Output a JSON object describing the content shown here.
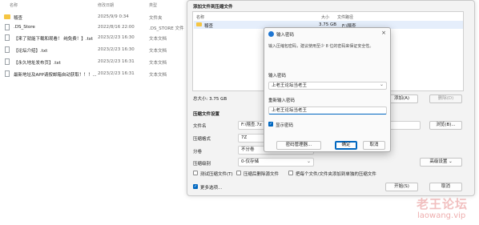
{
  "file_list": {
    "headers": {
      "name": "名称",
      "date": "修改日期",
      "type": "类型"
    },
    "rows": [
      {
        "name": "稽查",
        "date": "2025/9/9 0:34",
        "type": "文件夹",
        "icon": "folder-icon"
      },
      {
        "name": ".DS_Store",
        "date": "2022/8/16 22:00",
        "type": ".DS_STORE 文件",
        "icon": "file-icon"
      },
      {
        "name": "【来了就能下载和观看！ 纯免费！】.txt",
        "date": "2023/2/23 16:30",
        "type": "文本文档",
        "icon": "text-file-icon"
      },
      {
        "name": "【论坛介绍】.txt",
        "date": "2023/2/23 16:30",
        "type": "文本文档",
        "icon": "text-file-icon"
      },
      {
        "name": "【永久地址发布页】.txt",
        "date": "2023/2/23 16:31",
        "type": "文本文档",
        "icon": "text-file-icon"
      },
      {
        "name": "最新地址及APP请按邮箱自动获取！！！...",
        "date": "2023/2/23 16:31",
        "type": "文本文档",
        "icon": "text-file-icon"
      }
    ]
  },
  "compress_window": {
    "add_section_title": "添加文件到压缩文件",
    "list_headers": {
      "name": "名称",
      "size": "大小",
      "path": "文件路径"
    },
    "list_rows": [
      {
        "name": "稽查",
        "size": "3.75 GB",
        "path": "F:\\稽查"
      }
    ],
    "total_size": "总大小: 3.75 GB",
    "add_button": "添加(A)",
    "delete_button": "删除(D)",
    "settings_title": "压缩文件设置",
    "filename_label": "文件名",
    "filename_value": "F:\\稽查.7z",
    "browse_button": "浏览(B)...",
    "format_label": "压缩格式",
    "format_value": "7Z",
    "split_label": "分卷",
    "split_value": "不分卷",
    "level_label": "压缩级别",
    "level_value": "0-仅存储",
    "advanced_button": "高级设置",
    "opt_test": "测试压缩文件(T)",
    "opt_delete": "压缩后删除源文件",
    "opt_each": "把每个文件/文件夹添加到单独的压缩文件",
    "more_options": "更多选项...",
    "start_button": "开始(S)",
    "cancel_button": "取消"
  },
  "password_dialog": {
    "title": "输入密码",
    "hint": "输入压缩包密码，建议使用至少 8 位的密码来保证安全性。",
    "pw_label": "输入密码",
    "pw_value": "上老王论坛当老王",
    "confirm_label": "重新输入密码",
    "confirm_value": "上老王论坛当老王",
    "show_pw": "显示密码",
    "manager_button": "密码管理器...",
    "ok_button": "确定",
    "cancel_button": "取消"
  },
  "watermark": {
    "line1": "老王论坛",
    "line2": "laowang.vip"
  },
  "colors": {
    "accent": "#0067c0",
    "folder": "#f5c542",
    "watermark": "#d94a4a"
  }
}
